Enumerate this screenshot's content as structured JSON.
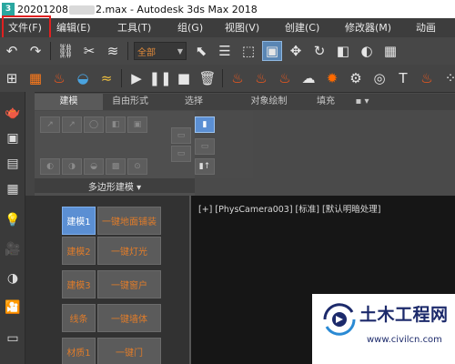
{
  "window": {
    "title_prefix": "20201208",
    "title_suffix": "2.max - Autodesk 3ds Max 2018",
    "app_icon_glyph": "3"
  },
  "menubar": {
    "items": [
      "文件(F)",
      "编辑(E)",
      "工具(T)",
      "组(G)",
      "视图(V)",
      "创建(C)",
      "修改器(M)",
      "动画"
    ]
  },
  "toolbar": {
    "selection_filter": "全部"
  },
  "ribbon": {
    "tabs": [
      "建模",
      "自由形式",
      "选择",
      "对象绘制",
      "填充",
      "▪ ▾"
    ],
    "panel_footer": "多边形建模 ▾"
  },
  "viewport": {
    "label": "[+] [PhysCamera003] [标准] [默认明暗处理]"
  },
  "command_panel": {
    "buttons": [
      {
        "left": "建模1",
        "right": "一键地面铺装",
        "active": true
      },
      {
        "left": "建模2",
        "right": "一键灯光",
        "active": false
      },
      {
        "left": "建模3",
        "right": "一键窗户",
        "active": false
      },
      {
        "left": "线条",
        "right": "一键墙体",
        "active": false
      },
      {
        "left": "材质1",
        "right": "一键门",
        "active": false
      }
    ]
  },
  "watermark": {
    "name": "土木工程网",
    "url": "www.civilcn.com"
  },
  "colors": {
    "accent_blue": "#5b8fd3",
    "button_text_orange": "#e07c2a",
    "highlight_red": "#e02020"
  }
}
